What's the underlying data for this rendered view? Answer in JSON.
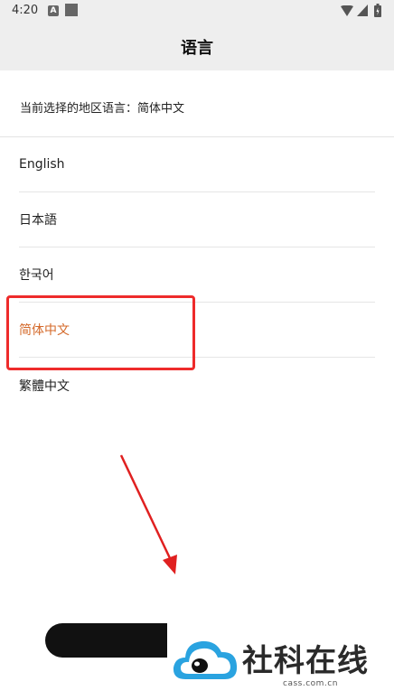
{
  "status_bar": {
    "time": "4:20",
    "a_badge": "A",
    "icons": [
      "a-badge-icon",
      "square-notification-icon",
      "wifi-icon",
      "signal-icon",
      "battery-icon"
    ]
  },
  "header": {
    "title": "语言"
  },
  "current_language": {
    "text": "当前选择的地区语言：简体中文"
  },
  "languages": [
    {
      "label": "English",
      "selected": false
    },
    {
      "label": "日本語",
      "selected": false
    },
    {
      "label": "한국어",
      "selected": false
    },
    {
      "label": "简体中文",
      "selected": true
    },
    {
      "label": "繁體中文",
      "selected": false
    }
  ],
  "colors": {
    "selected_text": "#d4692a",
    "highlight_border": "#ee2b2b",
    "arrow": "#e02020",
    "header_bg": "#eeeeee",
    "button_bg": "#111111",
    "logo_blue": "#2aa3e0"
  },
  "watermark": {
    "title": "社科在线",
    "url": "cass.com.cn"
  }
}
